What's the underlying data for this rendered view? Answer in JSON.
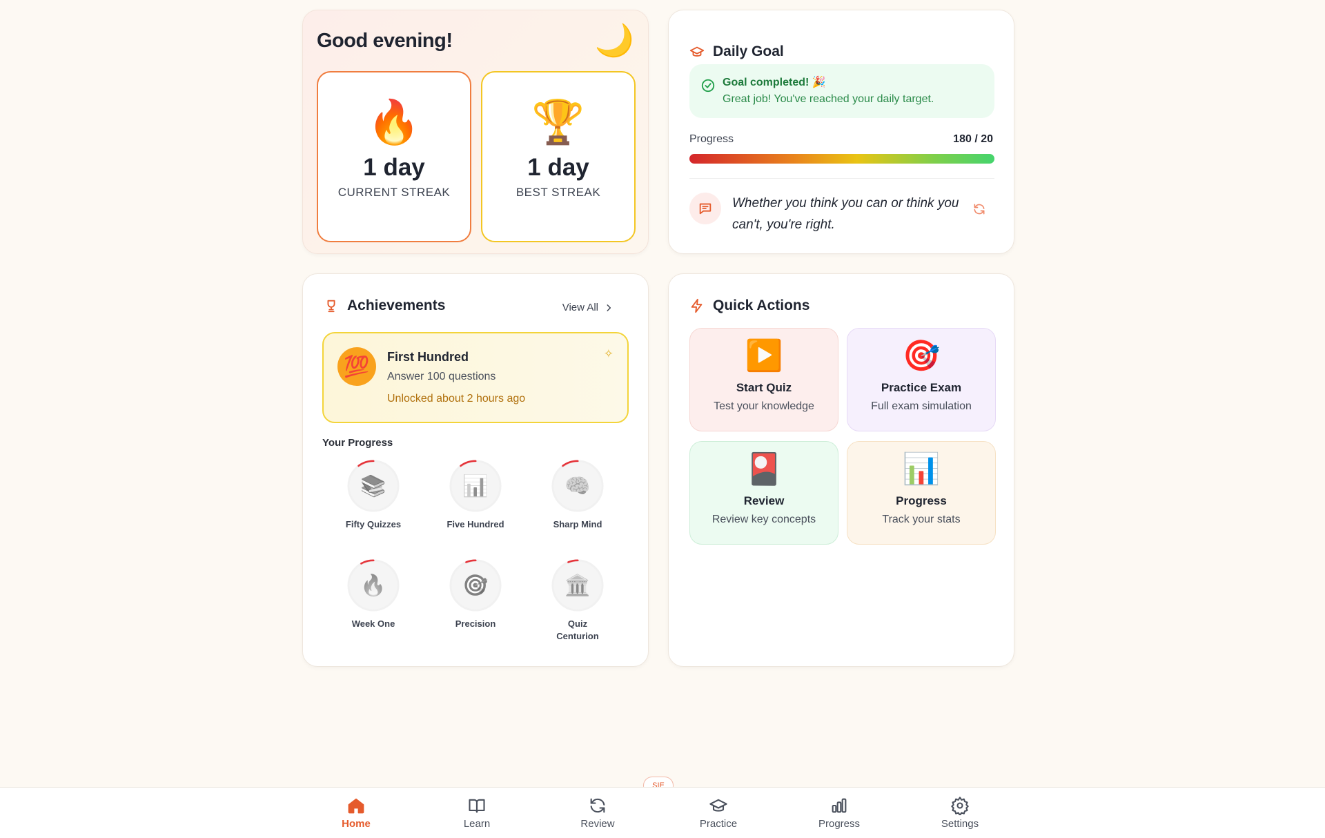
{
  "greeting": {
    "title": "Good evening!",
    "moon_icon": "🌙"
  },
  "streaks": {
    "current": {
      "icon": "🔥",
      "value": "1 day",
      "label": "CURRENT STREAK"
    },
    "best": {
      "icon": "🏆",
      "value": "1 day",
      "label": "BEST STREAK"
    }
  },
  "daily_goal": {
    "title": "Daily Goal",
    "status_title": "Goal completed! 🎉",
    "status_text": "Great job! You've reached your daily target.",
    "progress_label": "Progress",
    "progress_value": "180 / 20",
    "progress_fraction": 1.0,
    "quote": "Whether you think you can or think you can't, you're right."
  },
  "achievements": {
    "title": "Achievements",
    "view_all": "View All",
    "highlight": {
      "icon": "💯",
      "title": "First Hundred",
      "description": "Answer 100 questions",
      "unlocked": "Unlocked about 2 hours ago"
    },
    "progress_title": "Your Progress",
    "badges": [
      {
        "name": "Fifty Quizzes",
        "icon": "📚",
        "progress": 0.1
      },
      {
        "name": "Five Hundred",
        "icon": "📊",
        "progress": 0.1
      },
      {
        "name": "Sharp Mind",
        "icon": "🧠",
        "progress": 0.1
      },
      {
        "name": "Week One",
        "icon": "🔥",
        "progress": 0.08
      },
      {
        "name": "Precision",
        "icon": "🎯",
        "progress": 0.06
      },
      {
        "name": "Quiz Centurion",
        "icon": "🏛️",
        "progress": 0.06
      }
    ]
  },
  "quick_actions": {
    "title": "Quick Actions",
    "items": [
      {
        "title": "Start Quiz",
        "subtitle": "Test your knowledge",
        "icon": "▶️"
      },
      {
        "title": "Practice Exam",
        "subtitle": "Full exam simulation",
        "icon": "🎯"
      },
      {
        "title": "Review",
        "subtitle": "Review key concepts",
        "icon": "🎴"
      },
      {
        "title": "Progress",
        "subtitle": "Track your stats",
        "icon": "📊"
      }
    ]
  },
  "nav": {
    "badge": "SIE",
    "items": [
      {
        "label": "Home"
      },
      {
        "label": "Learn"
      },
      {
        "label": "Review"
      },
      {
        "label": "Practice"
      },
      {
        "label": "Progress"
      },
      {
        "label": "Settings"
      }
    ]
  },
  "colors": {
    "accent": "#e55b2c",
    "success": "#1d7a3b",
    "streak_border": "#f07d3f",
    "best_border": "#f3c623"
  }
}
